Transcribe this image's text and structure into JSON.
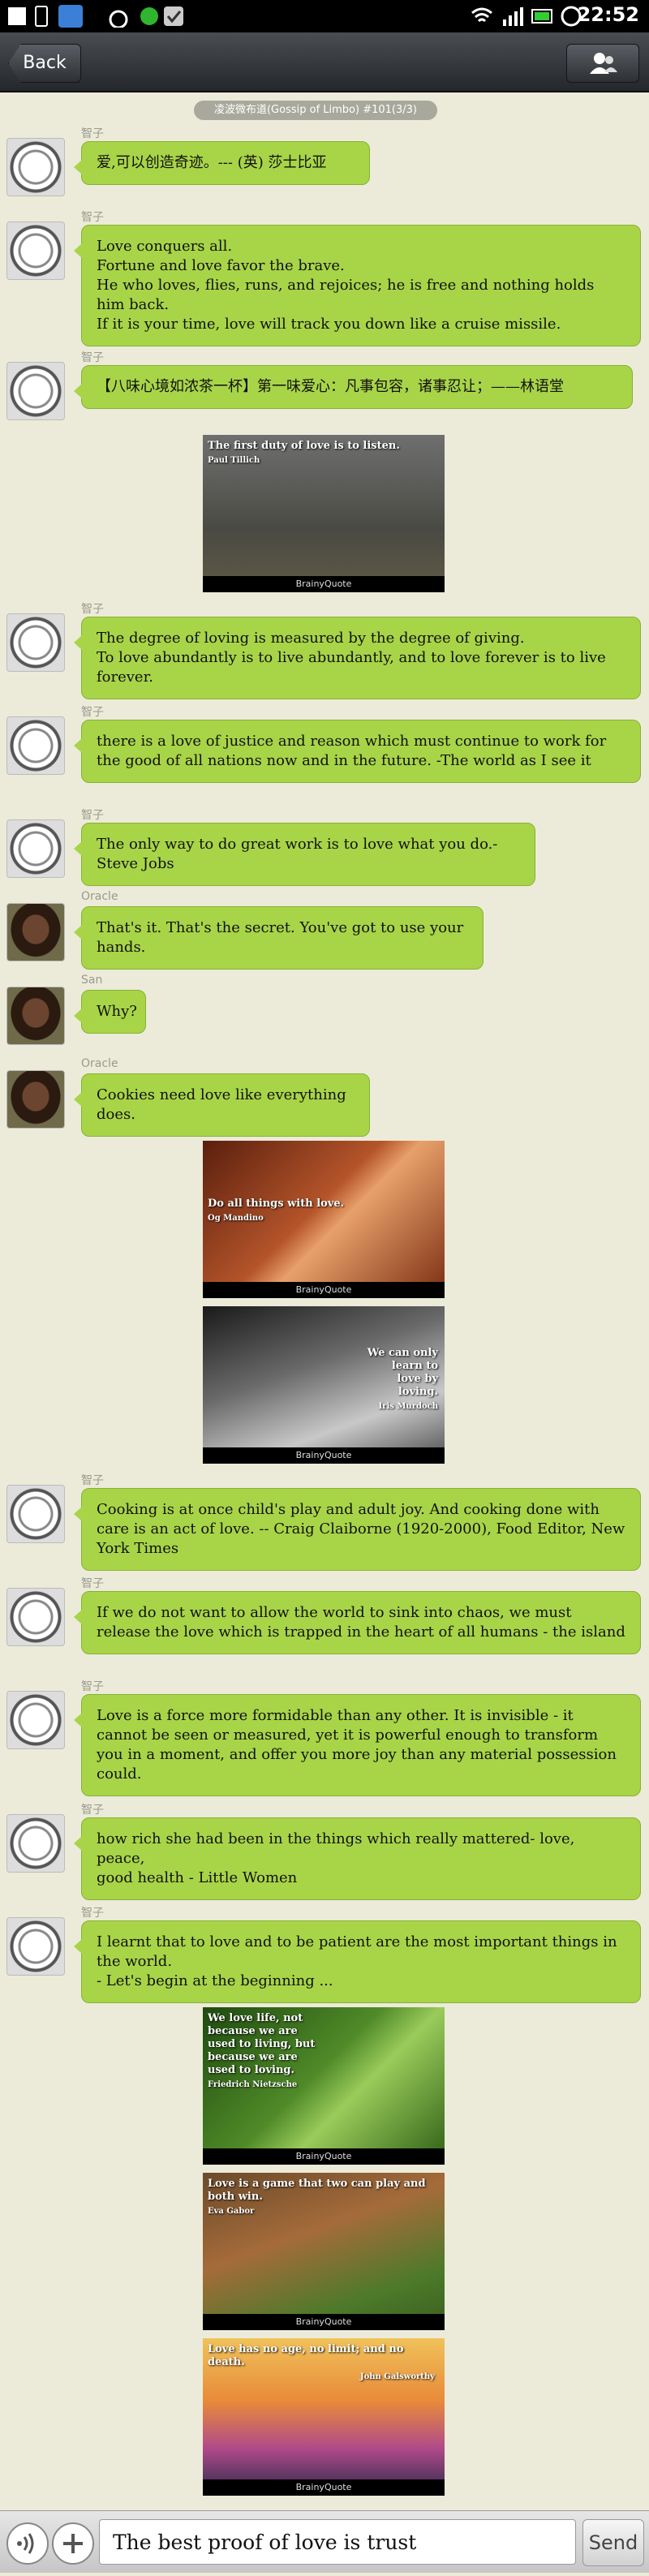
{
  "status_bar": {
    "time": "22:52",
    "left_icons": [
      "sim-icon",
      "phone-icon",
      "qq-icon",
      "signal-arc-icon",
      "sync-icon",
      "check-icon"
    ],
    "right_icons": [
      "wifi-icon",
      "cell-signal-icon",
      "battery-icon",
      "alarm-icon"
    ]
  },
  "header": {
    "back_label": "Back",
    "contacts_icon": "contacts-icon"
  },
  "group_title": "凌波微布道(Gossip of Limbo) #101(3/3)",
  "messages": [
    {
      "sender": "智子",
      "text": "爱,可以创造奇迹。--- (英) 莎士比亚"
    },
    {
      "sender": "智子",
      "text": "Love conquers all.\nFortune and love favor the brave.\nHe who loves, flies, runs, and rejoices; he is free and nothing holds him back.\nIf it is your time, love will track you down like a cruise missile."
    },
    {
      "sender": "智子",
      "text": "【八味心境如浓茶一杯】第一味爱心：凡事包容，诸事忍让；——林语堂"
    },
    {
      "sender": "智子",
      "text": "The degree of loving is measured by the degree of giving.\nTo love abundantly is to live abundantly, and to love forever is to live forever."
    },
    {
      "sender": "智子",
      "text": "there is a love of justice and reason which must continue to work for the good of all nations now and in the future. -The world as I see it"
    },
    {
      "sender": "智子",
      "text": "The only way to do great work is to love what you do.-Steve Jobs"
    },
    {
      "sender": "Oracle",
      "text": "That's it. That's the secret.  You've got to use your hands."
    },
    {
      "sender": "San",
      "text": "Why?"
    },
    {
      "sender": "Oracle",
      "text": "Cookies need love like everything does."
    },
    {
      "sender": "智子",
      "text": "Cooking is at once child's play and adult joy. And cooking done with care is an act of love. -- Craig Claiborne (1920-2000), Food Editor, New York Times"
    },
    {
      "sender": "智子",
      "text": "If we do not want to allow the world to sink into chaos, we must release the love which is trapped in the heart of all humans - the island"
    },
    {
      "sender": "智子",
      "text": "Love is a force more formidable than any other. It is invisible - it cannot be seen or measured, yet it is powerful enough to transform you in a moment, and offer you more joy than any material possession could."
    },
    {
      "sender": "智子",
      "text": "how rich she had been in the things which really mattered- love, peace,\ngood health - Little Women"
    },
    {
      "sender": "智子",
      "text": "I learnt that to love and to be patient are the most important things in the world.\n - Let's begin at the beginning ..."
    }
  ],
  "images": [
    {
      "quote": "The first duty of love is to listen.",
      "author": "Paul Tillich",
      "footer": "BrainyQuote"
    },
    {
      "quote": "Do all things with love.",
      "author": "Og Mandino",
      "footer": "BrainyQuote"
    },
    {
      "quote": "We can only learn to love by loving.",
      "author": "Iris Murdoch",
      "footer": "BrainyQuote"
    },
    {
      "quote": "We love life, not because we are used to living, but because we are used to loving.",
      "author": "Friedrich Nietzsche",
      "footer": "BrainyQuote"
    },
    {
      "quote": "Love is a game that two can play and both win.",
      "author": "Eva Gabor",
      "footer": "BrainyQuote"
    },
    {
      "quote": "Love has no age, no limit; and no death.",
      "author": "John Galsworthy",
      "footer": "BrainyQuote"
    }
  ],
  "input": {
    "value": "The best proof of love is trust",
    "send_label": "Send",
    "voice_icon": "voice-icon",
    "plus_icon": "plus-icon"
  }
}
